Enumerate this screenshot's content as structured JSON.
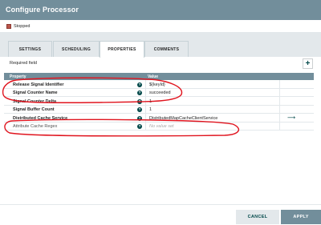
{
  "dialog": {
    "title": "Configure Processor"
  },
  "status": {
    "text": "Stopped",
    "color": "#ba554a"
  },
  "tabs": [
    {
      "label": "SETTINGS",
      "active": false
    },
    {
      "label": "SCHEDULING",
      "active": false
    },
    {
      "label": "PROPERTIES",
      "active": true
    },
    {
      "label": "COMMENTS",
      "active": false
    }
  ],
  "properties": {
    "required_label": "Required field",
    "add_icon": "plus-icon",
    "columns": {
      "property": "Property",
      "value": "Value"
    },
    "rows": [
      {
        "name": "Release Signal Identifier",
        "value": "${keyId}",
        "required": true,
        "no_value": false
      },
      {
        "name": "Signal Counter Name",
        "value": "succeeded",
        "required": true,
        "no_value": false
      },
      {
        "name": "Signal Counter Delta",
        "value": "1",
        "required": true,
        "no_value": false
      },
      {
        "name": "Signal Buffer Count",
        "value": "1",
        "required": true,
        "no_value": false
      },
      {
        "name": "Distributed Cache Service",
        "value": "DistributedMapCacheClientService",
        "required": true,
        "no_value": false,
        "goto_icon": "arrow-right-icon"
      },
      {
        "name": "Attribute Cache Regex",
        "value": "No value set",
        "required": false,
        "no_value": true
      }
    ]
  },
  "footer": {
    "cancel_label": "CANCEL",
    "apply_label": "APPLY"
  },
  "colors": {
    "header": "#728e9b",
    "accent": "#004849",
    "annotation": "#e0141e"
  }
}
